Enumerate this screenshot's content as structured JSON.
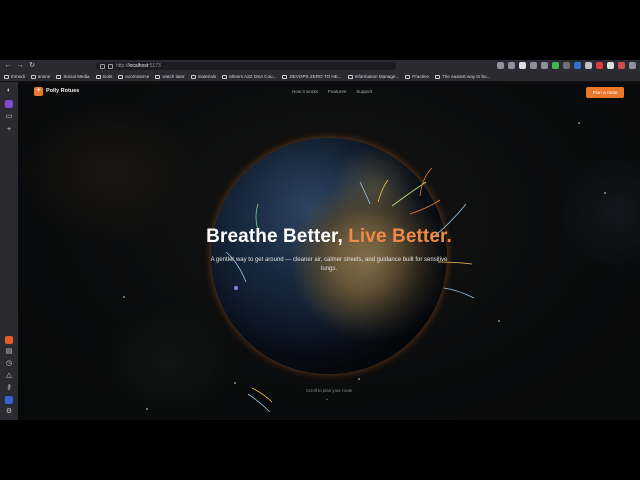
{
  "browser": {
    "url_prefix": "http://",
    "url_host": "localhost",
    "url_port": ":5173",
    "bookmarks": [
      "Ihmodi",
      "anime",
      "Social Media",
      "tools",
      "ecommerce",
      "watch later",
      "materials",
      "Miners A2Z DSA Cou...",
      "DEVOPS ZERO TO HE...",
      "Information Manage...",
      "Practice",
      "The easiest way to bu..."
    ]
  },
  "nav": {
    "logo_glyph": "✈",
    "brand": "Polly Rotues",
    "links": [
      "How it works",
      "Features",
      "Support"
    ],
    "cta": "Plan a route"
  },
  "hero": {
    "title_main": "Breathe Better, ",
    "title_accent": "Live Better.",
    "subtitle": "A gentler way to get around — cleaner air, calmer streets, and guidance built for sensitive lungs.",
    "scroll_hint": "Scroll to plan your route",
    "scroll_chevron": "⌄"
  },
  "colors": {
    "accent": "#e9782b",
    "accent_text": "#ef8a47",
    "background": "#0b0c0d"
  }
}
